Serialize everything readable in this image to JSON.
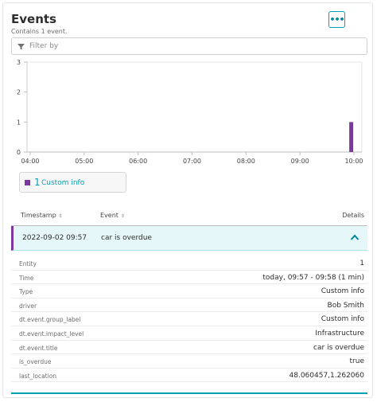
{
  "panel": {
    "title": "Events",
    "subtitle": "Contains 1 event."
  },
  "menu": {
    "icon": "more-horizontal-icon",
    "label": "•••"
  },
  "filter": {
    "placeholder": "Filter by",
    "value": "",
    "icon": "filter-icon"
  },
  "chart_data": {
    "type": "bar",
    "x": [
      "04:00",
      "05:00",
      "06:00",
      "07:00",
      "08:00",
      "09:00",
      "10:00"
    ],
    "y_ticks": [
      0,
      1,
      2,
      3
    ],
    "ylim": [
      0,
      3
    ],
    "series": [
      {
        "name": "Custom info",
        "color": "#7c38a1",
        "points": [
          {
            "x": "09:57",
            "y": 1
          }
        ]
      }
    ]
  },
  "legend": {
    "count": "1",
    "label": "Custom info",
    "color": "#7c38a1"
  },
  "table": {
    "headers": {
      "timestamp": "Timestamp",
      "event": "Event",
      "details": "Details"
    },
    "sort_glyph": "⇕",
    "row": {
      "timestamp": "2022-09-02 09:57",
      "event": "car is overdue"
    }
  },
  "details": [
    {
      "key": "Entity",
      "value": "1"
    },
    {
      "key": "Time",
      "value": "today, 09:57 - 09:58 (1 min)"
    },
    {
      "key": "Type",
      "value": "Custom info"
    },
    {
      "key": "driver",
      "value": "Bob Smith"
    },
    {
      "key": "dt.event.group_label",
      "value": "Custom info"
    },
    {
      "key": "dt.event.impact_level",
      "value": "Infrastructure"
    },
    {
      "key": "dt.event.title",
      "value": "car is overdue"
    },
    {
      "key": "is_overdue",
      "value": "true"
    },
    {
      "key": "last_location",
      "value": "48.060457,1.262060"
    }
  ],
  "colors": {
    "accent": "#00a1b2",
    "series": "#7c38a1"
  }
}
